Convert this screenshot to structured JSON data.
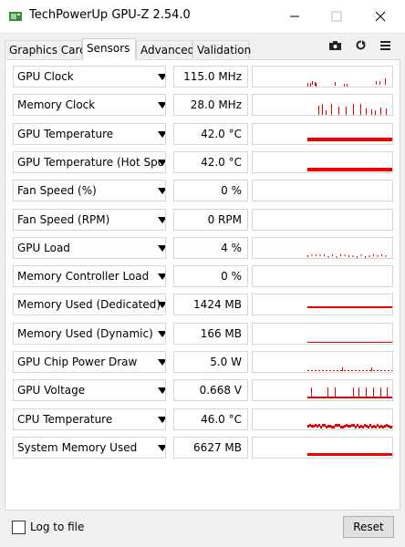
{
  "window": {
    "title": "TechPowerUp GPU-Z 2.54.0"
  },
  "tabs": [
    {
      "label": "Graphics Card"
    },
    {
      "label": "Sensors"
    },
    {
      "label": "Advanced"
    },
    {
      "label": "Validation"
    }
  ],
  "toolbar_icons": [
    "camera-icon",
    "refresh-icon",
    "menu-icon"
  ],
  "accent_color": "#ee0000",
  "sensors": [
    {
      "name": "GPU Clock",
      "value": "115.0 MHz"
    },
    {
      "name": "Memory Clock",
      "value": "28.0 MHz"
    },
    {
      "name": "GPU Temperature",
      "value": "42.0 °C"
    },
    {
      "name": "GPU Temperature (Hot Spot)",
      "value": "42.0 °C"
    },
    {
      "name": "Fan Speed (%)",
      "value": "0 %"
    },
    {
      "name": "Fan Speed (RPM)",
      "value": "0 RPM"
    },
    {
      "name": "GPU Load",
      "value": "4 %"
    },
    {
      "name": "Memory Controller Load",
      "value": "0 %"
    },
    {
      "name": "Memory Used (Dedicated)",
      "value": "1424 MB"
    },
    {
      "name": "Memory Used (Dynamic)",
      "value": "166 MB"
    },
    {
      "name": "GPU Chip Power Draw",
      "value": "5.0 W"
    },
    {
      "name": "GPU Voltage",
      "value": "0.668 V"
    },
    {
      "name": "CPU Temperature",
      "value": "46.0 °C"
    },
    {
      "name": "System Memory Used",
      "value": "6627 MB"
    }
  ],
  "footer": {
    "log_label": "Log to file",
    "reset_label": "Reset"
  }
}
